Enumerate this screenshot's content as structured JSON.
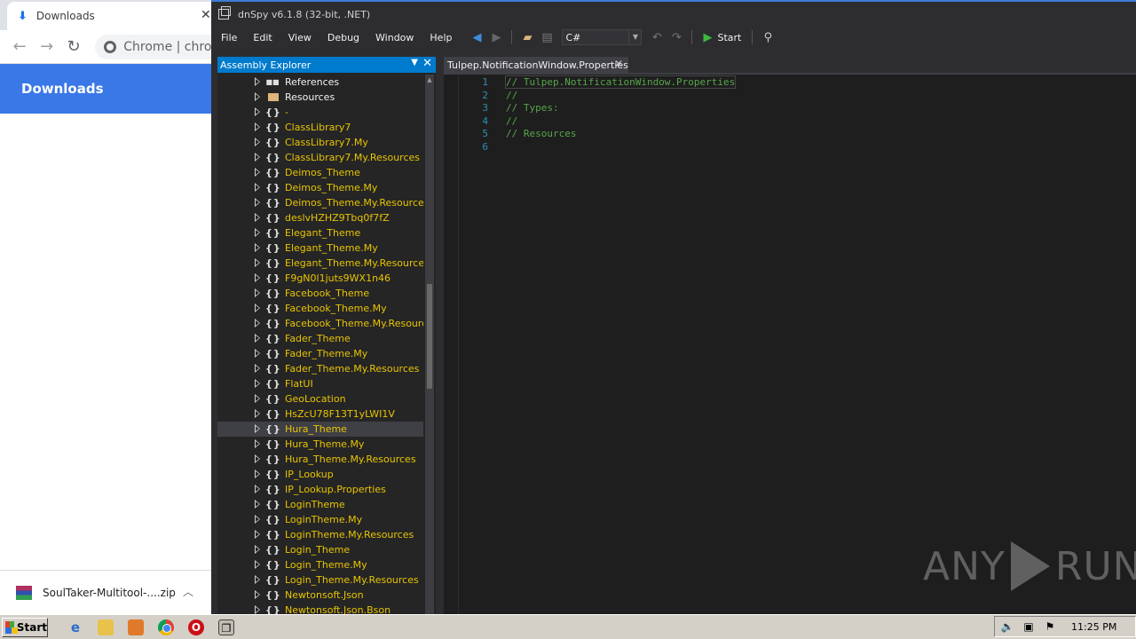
{
  "chrome": {
    "tab_title": "Downloads",
    "tab_close": "✕",
    "omnibox_text": "Chrome | chro",
    "page_header": "Downloads",
    "download_item": "SoulTaker-Multitool-....zip"
  },
  "dnspy": {
    "title": "dnSpy v6.1.8 (32-bit, .NET)",
    "menu": [
      "File",
      "Edit",
      "View",
      "Debug",
      "Window",
      "Help"
    ],
    "language": "C#",
    "start_label": "Start",
    "explorer_title": "Assembly Explorer",
    "tree": [
      {
        "label": "References",
        "icon": "references",
        "plain": true
      },
      {
        "label": "Resources",
        "icon": "folder",
        "plain": true
      },
      {
        "label": "-",
        "icon": "namespace",
        "plain": false
      },
      {
        "label": "ClassLibrary7",
        "icon": "namespace",
        "plain": false
      },
      {
        "label": "ClassLibrary7.My",
        "icon": "namespace",
        "plain": false
      },
      {
        "label": "ClassLibrary7.My.Resources",
        "icon": "namespace",
        "plain": false
      },
      {
        "label": "Deimos_Theme",
        "icon": "namespace",
        "plain": false
      },
      {
        "label": "Deimos_Theme.My",
        "icon": "namespace",
        "plain": false
      },
      {
        "label": "Deimos_Theme.My.Resources",
        "icon": "namespace",
        "plain": false
      },
      {
        "label": "deslvHZHZ9Tbq0f7fZ",
        "icon": "namespace",
        "plain": false
      },
      {
        "label": "Elegant_Theme",
        "icon": "namespace",
        "plain": false
      },
      {
        "label": "Elegant_Theme.My",
        "icon": "namespace",
        "plain": false
      },
      {
        "label": "Elegant_Theme.My.Resources",
        "icon": "namespace",
        "plain": false
      },
      {
        "label": "F9gN0l1juts9WX1n46",
        "icon": "namespace",
        "plain": false
      },
      {
        "label": "Facebook_Theme",
        "icon": "namespace",
        "plain": false
      },
      {
        "label": "Facebook_Theme.My",
        "icon": "namespace",
        "plain": false
      },
      {
        "label": "Facebook_Theme.My.Resources",
        "icon": "namespace",
        "plain": false
      },
      {
        "label": "Fader_Theme",
        "icon": "namespace",
        "plain": false
      },
      {
        "label": "Fader_Theme.My",
        "icon": "namespace",
        "plain": false
      },
      {
        "label": "Fader_Theme.My.Resources",
        "icon": "namespace",
        "plain": false
      },
      {
        "label": "FlatUI",
        "icon": "namespace",
        "plain": false
      },
      {
        "label": "GeoLocation",
        "icon": "namespace",
        "plain": false
      },
      {
        "label": "HsZcU78F13T1yLWI1V",
        "icon": "namespace",
        "plain": false
      },
      {
        "label": "Hura_Theme",
        "icon": "namespace",
        "plain": false,
        "selected": true
      },
      {
        "label": "Hura_Theme.My",
        "icon": "namespace",
        "plain": false
      },
      {
        "label": "Hura_Theme.My.Resources",
        "icon": "namespace",
        "plain": false
      },
      {
        "label": "IP_Lookup",
        "icon": "namespace",
        "plain": false
      },
      {
        "label": "IP_Lookup.Properties",
        "icon": "namespace",
        "plain": false
      },
      {
        "label": "LoginTheme",
        "icon": "namespace",
        "plain": false
      },
      {
        "label": "LoginTheme.My",
        "icon": "namespace",
        "plain": false
      },
      {
        "label": "LoginTheme.My.Resources",
        "icon": "namespace",
        "plain": false
      },
      {
        "label": "Login_Theme",
        "icon": "namespace",
        "plain": false
      },
      {
        "label": "Login_Theme.My",
        "icon": "namespace",
        "plain": false
      },
      {
        "label": "Login_Theme.My.Resources",
        "icon": "namespace",
        "plain": false
      },
      {
        "label": "Newtonsoft.Json",
        "icon": "namespace",
        "plain": false
      },
      {
        "label": "Newtonsoft.Json.Bson",
        "icon": "namespace",
        "plain": false
      }
    ],
    "document_tab": "Tulpep.NotificationWindow.Properties",
    "code_lines": [
      {
        "no": "1",
        "text": "// Tulpep.NotificationWindow.Properties"
      },
      {
        "no": "2",
        "text": "//"
      },
      {
        "no": "3",
        "text": "// Types:"
      },
      {
        "no": "4",
        "text": "//"
      },
      {
        "no": "5",
        "text": "// Resources"
      },
      {
        "no": "6",
        "text": ""
      }
    ]
  },
  "watermark": {
    "left": "ANY",
    "right": "RUN"
  },
  "taskbar": {
    "start_label": "Start",
    "clock": "11:25 PM"
  },
  "colors": {
    "accent": "#007acc",
    "namespace_text": "#e8c400",
    "comment": "#57a64a",
    "line_number": "#2b91af"
  }
}
